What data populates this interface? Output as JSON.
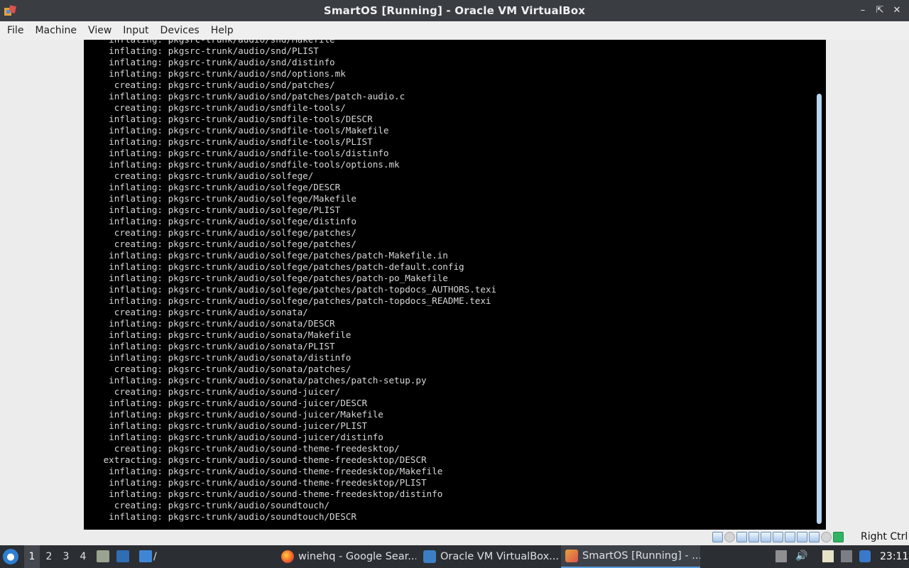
{
  "window": {
    "title": "SmartOS [Running] - Oracle VM VirtualBox",
    "icon": "virtualbox-vm-icon"
  },
  "menubar": [
    "File",
    "Machine",
    "View",
    "Input",
    "Devices",
    "Help"
  ],
  "console": {
    "lines": [
      {
        "verb": "inflating:",
        "path": "pkgsrc-trunk/audio/snd/Makefile"
      },
      {
        "verb": "inflating:",
        "path": "pkgsrc-trunk/audio/snd/PLIST"
      },
      {
        "verb": "inflating:",
        "path": "pkgsrc-trunk/audio/snd/distinfo"
      },
      {
        "verb": "inflating:",
        "path": "pkgsrc-trunk/audio/snd/options.mk"
      },
      {
        "verb": "creating:",
        "path": "pkgsrc-trunk/audio/snd/patches/"
      },
      {
        "verb": "inflating:",
        "path": "pkgsrc-trunk/audio/snd/patches/patch-audio.c"
      },
      {
        "verb": "creating:",
        "path": "pkgsrc-trunk/audio/sndfile-tools/"
      },
      {
        "verb": "inflating:",
        "path": "pkgsrc-trunk/audio/sndfile-tools/DESCR"
      },
      {
        "verb": "inflating:",
        "path": "pkgsrc-trunk/audio/sndfile-tools/Makefile"
      },
      {
        "verb": "inflating:",
        "path": "pkgsrc-trunk/audio/sndfile-tools/PLIST"
      },
      {
        "verb": "inflating:",
        "path": "pkgsrc-trunk/audio/sndfile-tools/distinfo"
      },
      {
        "verb": "inflating:",
        "path": "pkgsrc-trunk/audio/sndfile-tools/options.mk"
      },
      {
        "verb": "creating:",
        "path": "pkgsrc-trunk/audio/solfege/"
      },
      {
        "verb": "inflating:",
        "path": "pkgsrc-trunk/audio/solfege/DESCR"
      },
      {
        "verb": "inflating:",
        "path": "pkgsrc-trunk/audio/solfege/Makefile"
      },
      {
        "verb": "inflating:",
        "path": "pkgsrc-trunk/audio/solfege/PLIST"
      },
      {
        "verb": "inflating:",
        "path": "pkgsrc-trunk/audio/solfege/distinfo"
      },
      {
        "verb": "creating:",
        "path": "pkgsrc-trunk/audio/solfege/patches/"
      },
      {
        "verb": "creating:",
        "path": "pkgsrc-trunk/audio/solfege/patches/"
      },
      {
        "verb": "inflating:",
        "path": "pkgsrc-trunk/audio/solfege/patches/patch-Makefile.in"
      },
      {
        "verb": "inflating:",
        "path": "pkgsrc-trunk/audio/solfege/patches/patch-default.config"
      },
      {
        "verb": "inflating:",
        "path": "pkgsrc-trunk/audio/solfege/patches/patch-po_Makefile"
      },
      {
        "verb": "inflating:",
        "path": "pkgsrc-trunk/audio/solfege/patches/patch-topdocs_AUTHORS.texi"
      },
      {
        "verb": "inflating:",
        "path": "pkgsrc-trunk/audio/solfege/patches/patch-topdocs_README.texi"
      },
      {
        "verb": "creating:",
        "path": "pkgsrc-trunk/audio/sonata/"
      },
      {
        "verb": "inflating:",
        "path": "pkgsrc-trunk/audio/sonata/DESCR"
      },
      {
        "verb": "inflating:",
        "path": "pkgsrc-trunk/audio/sonata/Makefile"
      },
      {
        "verb": "inflating:",
        "path": "pkgsrc-trunk/audio/sonata/PLIST"
      },
      {
        "verb": "inflating:",
        "path": "pkgsrc-trunk/audio/sonata/distinfo"
      },
      {
        "verb": "creating:",
        "path": "pkgsrc-trunk/audio/sonata/patches/"
      },
      {
        "verb": "inflating:",
        "path": "pkgsrc-trunk/audio/sonata/patches/patch-setup.py"
      },
      {
        "verb": "creating:",
        "path": "pkgsrc-trunk/audio/sound-juicer/"
      },
      {
        "verb": "inflating:",
        "path": "pkgsrc-trunk/audio/sound-juicer/DESCR"
      },
      {
        "verb": "inflating:",
        "path": "pkgsrc-trunk/audio/sound-juicer/Makefile"
      },
      {
        "verb": "inflating:",
        "path": "pkgsrc-trunk/audio/sound-juicer/PLIST"
      },
      {
        "verb": "inflating:",
        "path": "pkgsrc-trunk/audio/sound-juicer/distinfo"
      },
      {
        "verb": "creating:",
        "path": "pkgsrc-trunk/audio/sound-theme-freedesktop/"
      },
      {
        "verb": "extracting:",
        "path": "pkgsrc-trunk/audio/sound-theme-freedesktop/DESCR"
      },
      {
        "verb": "inflating:",
        "path": "pkgsrc-trunk/audio/sound-theme-freedesktop/Makefile"
      },
      {
        "verb": "inflating:",
        "path": "pkgsrc-trunk/audio/sound-theme-freedesktop/PLIST"
      },
      {
        "verb": "inflating:",
        "path": "pkgsrc-trunk/audio/sound-theme-freedesktop/distinfo"
      },
      {
        "verb": "creating:",
        "path": "pkgsrc-trunk/audio/soundtouch/"
      },
      {
        "verb": "inflating:",
        "path": "pkgsrc-trunk/audio/soundtouch/DESCR"
      }
    ]
  },
  "statusbar": {
    "icons": [
      "hard-disk-icon",
      "optical-drive-icon",
      "audio-icon",
      "network-icon",
      "usb-icon",
      "shared-folders-icon",
      "display-icon",
      "recording-icon",
      "cpu-icon",
      "mouse-integration-icon",
      "keyboard-icon"
    ],
    "host_key": "Right Ctrl"
  },
  "taskbar": {
    "workspaces": [
      "1",
      "2",
      "3",
      "4"
    ],
    "path_label": "/",
    "tasks": [
      {
        "label": "winehq - Google Sear...",
        "icon": "firefox-icon",
        "active": false
      },
      {
        "label": "Oracle VM VirtualBox...",
        "icon": "virtualbox-manager-icon",
        "active": false
      },
      {
        "label": "SmartOS [Running] - ...",
        "icon": "virtualbox-vm-icon",
        "active": true
      }
    ],
    "clock": "23:11"
  }
}
